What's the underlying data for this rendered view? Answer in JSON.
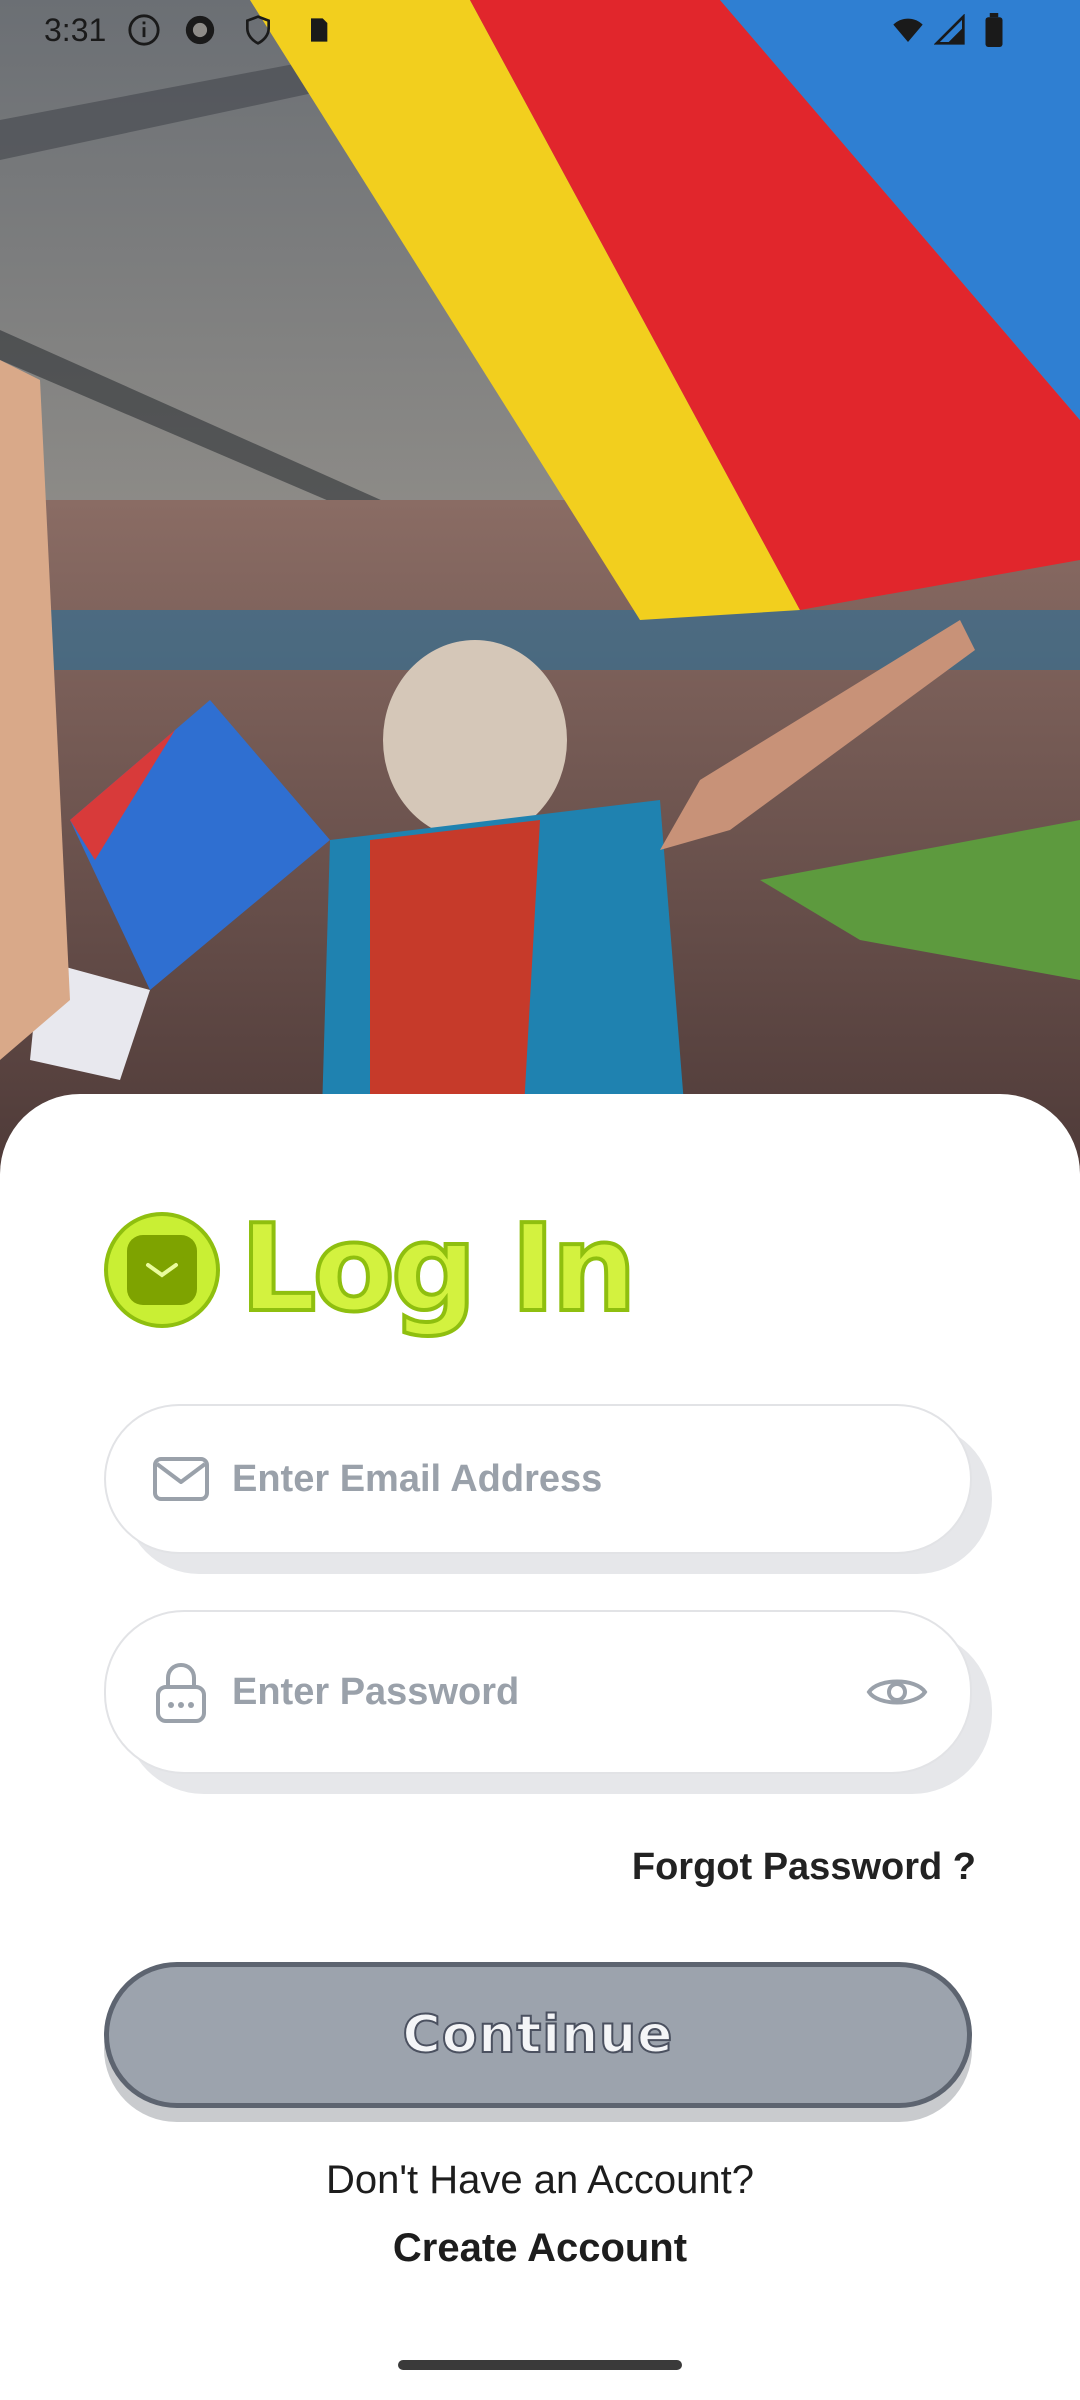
{
  "status_bar": {
    "time": "3:31",
    "icons": [
      "info-icon",
      "sync-icon",
      "shield-icon",
      "sd-card-icon",
      "wifi-icon",
      "signal-icon",
      "battery-icon"
    ]
  },
  "hero": {
    "image_description_icon": "stadium-fan-waving-flag-image"
  },
  "login": {
    "title": "Log In",
    "badge_icon": "mail-icon",
    "email": {
      "placeholder": "Enter Email Address",
      "value": "",
      "icon": "mail-outline-icon"
    },
    "password": {
      "placeholder": "Enter Password",
      "value": "",
      "icon": "lock-icon",
      "toggle_icon": "eye-icon"
    },
    "forgot_label": "Forgot Password ?",
    "continue_label": "Continue",
    "no_account_text": "Don't Have an Account?",
    "create_account_label": "Create Account"
  },
  "colors": {
    "accent_green": "#d3f23f",
    "accent_green_outline": "#8fbf0f",
    "button_disabled": "#9ca3ad",
    "placeholder": "#9aa1aa"
  }
}
